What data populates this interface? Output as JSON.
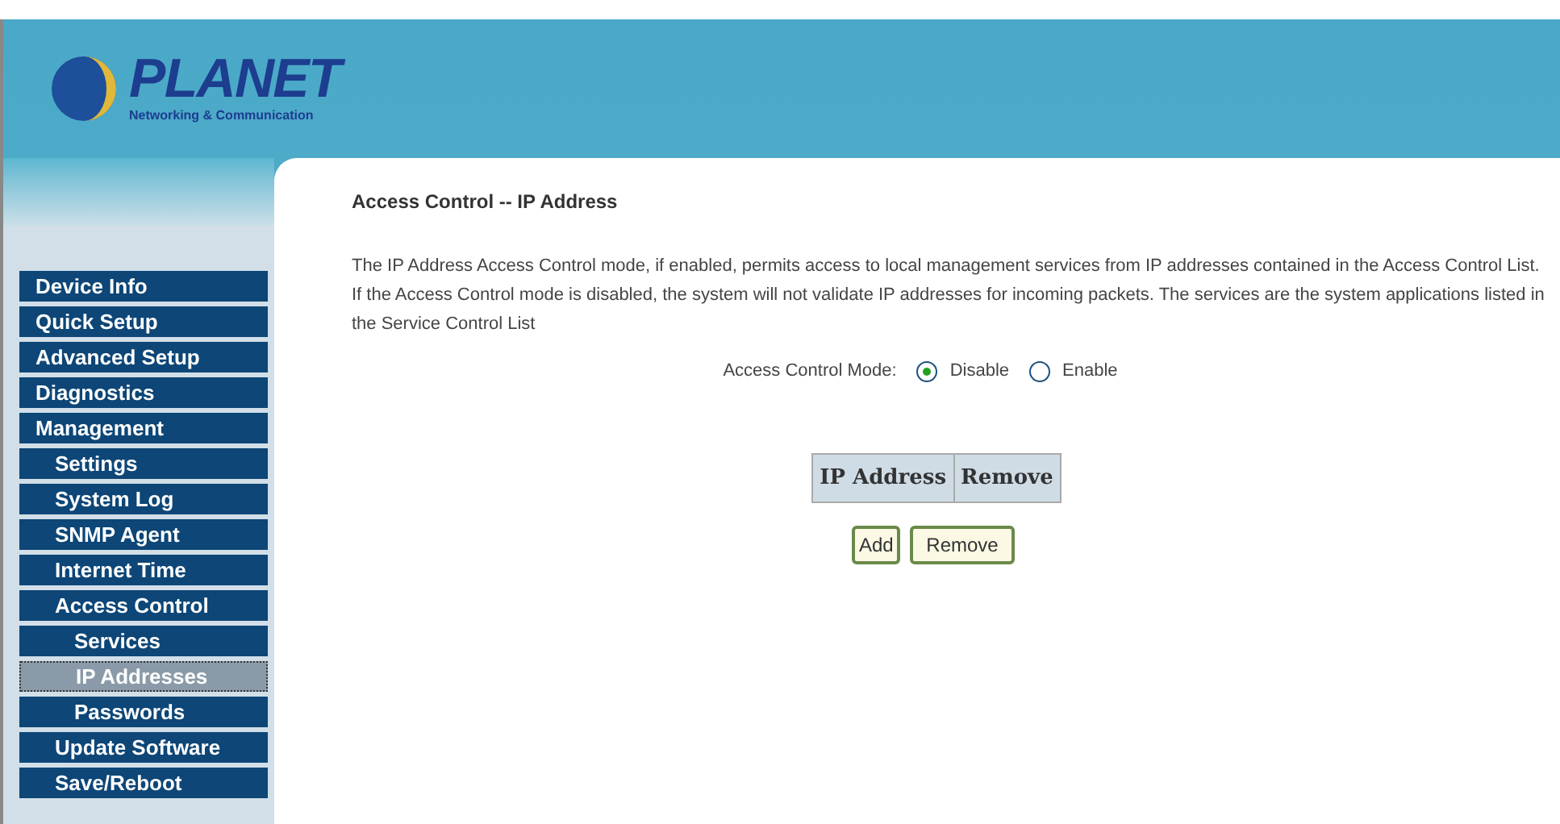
{
  "logo": {
    "name": "PLANET",
    "tagline": "Networking & Communication"
  },
  "sidebar": {
    "items": [
      {
        "label": "Device Info",
        "selected": false
      },
      {
        "label": "Quick Setup",
        "selected": false
      },
      {
        "label": "Advanced Setup",
        "selected": false
      },
      {
        "label": "Diagnostics",
        "selected": false
      },
      {
        "label": "Management",
        "selected": false,
        "children": [
          {
            "label": "Settings",
            "selected": false
          },
          {
            "label": "System Log",
            "selected": false
          },
          {
            "label": "SNMP Agent",
            "selected": false
          },
          {
            "label": "Internet Time",
            "selected": false
          },
          {
            "label": "Access Control",
            "selected": false,
            "children": [
              {
                "label": "Services",
                "selected": false
              },
              {
                "label": "IP Addresses",
                "selected": true
              },
              {
                "label": "Passwords",
                "selected": false
              }
            ]
          },
          {
            "label": "Update Software",
            "selected": false
          },
          {
            "label": "Save/Reboot",
            "selected": false
          }
        ]
      }
    ]
  },
  "content": {
    "title": "Access Control -- IP Address",
    "description": "The IP Address Access Control mode, if enabled, permits access to local management services from IP addresses contained in the Access Control List. If the Access Control mode is disabled, the system will not validate IP addresses for incoming packets. The services are the system applications listed in the Service Control List",
    "mode": {
      "label": "Access Control Mode:",
      "options": [
        {
          "label": "Disable",
          "selected": true
        },
        {
          "label": "Enable",
          "selected": false
        }
      ]
    },
    "table": {
      "columns": [
        "IP Address",
        "Remove"
      ]
    },
    "buttons": [
      "Add",
      "Remove"
    ]
  }
}
